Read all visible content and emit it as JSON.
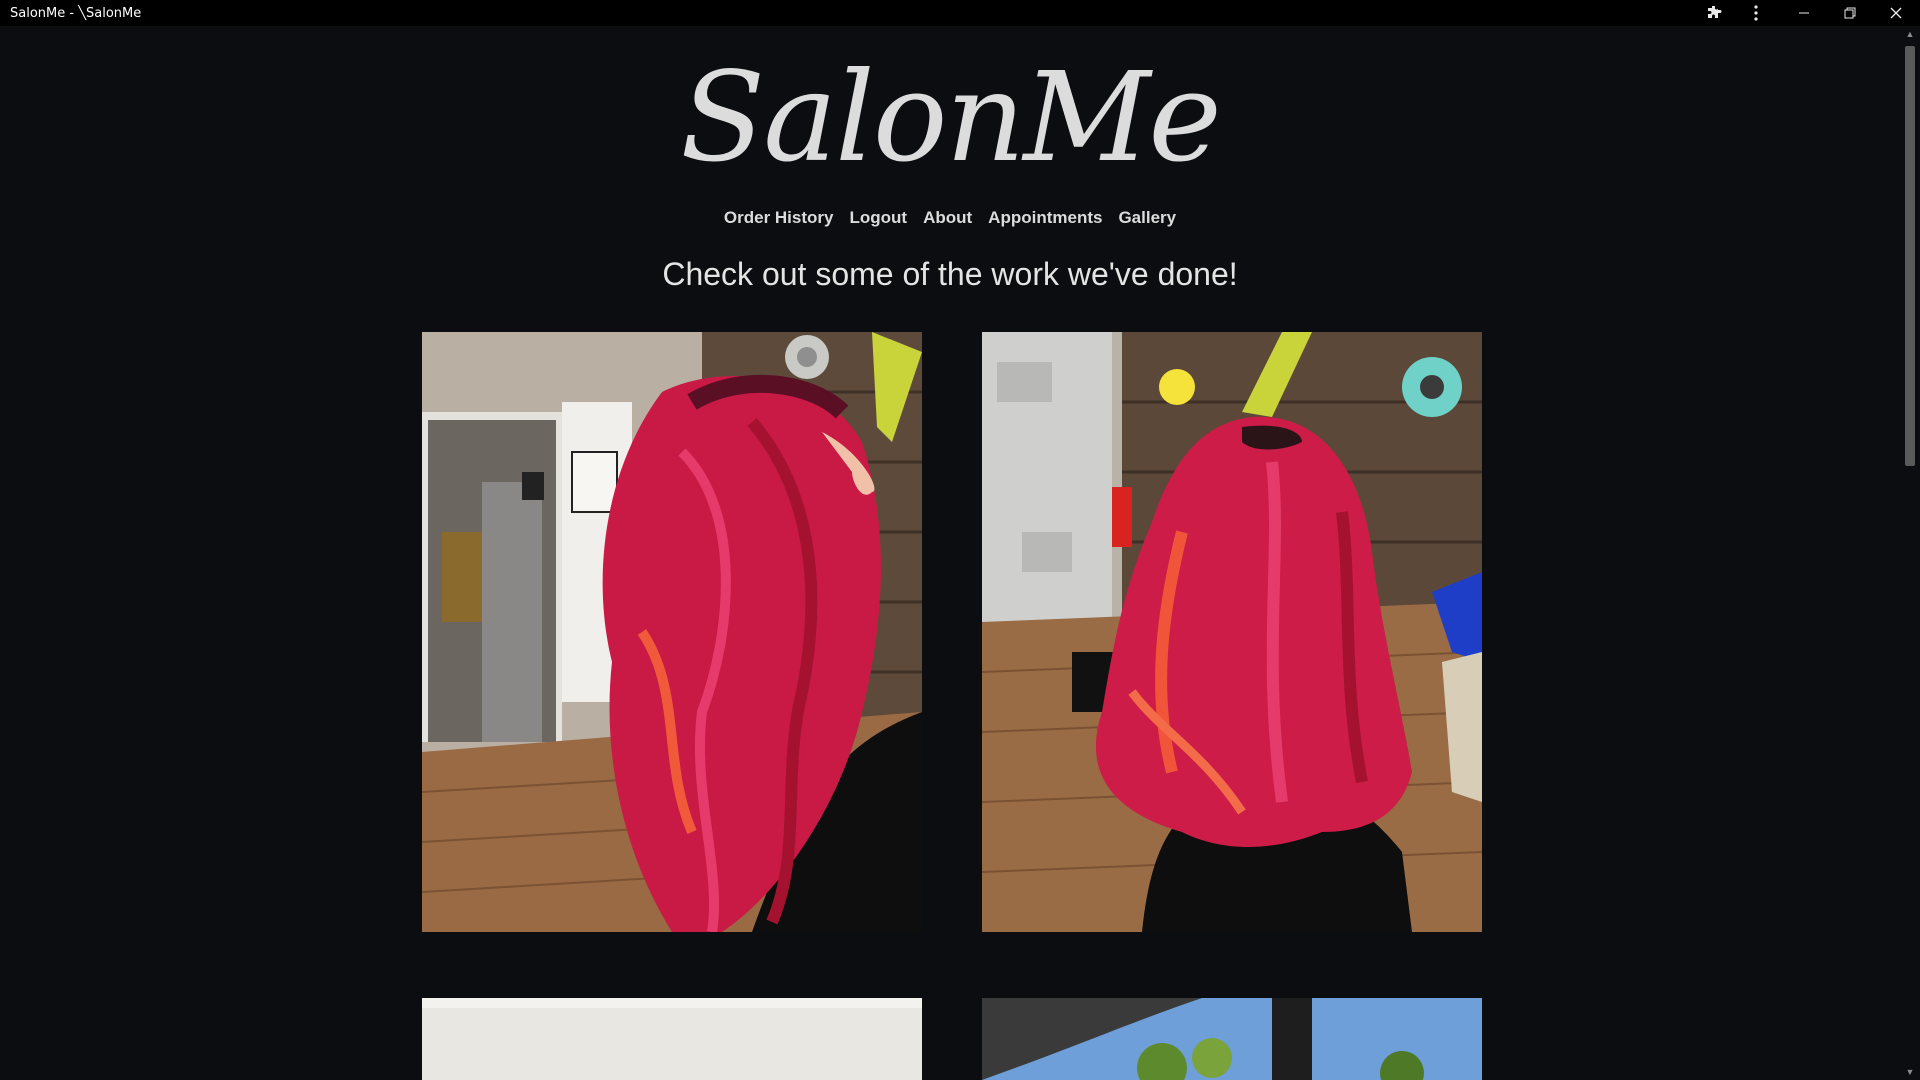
{
  "window": {
    "title": "SalonMe - ╲SalonMe",
    "icons": [
      "extensions-icon",
      "menu-icon",
      "minimize-icon",
      "restore-icon",
      "close-icon"
    ]
  },
  "site": {
    "logo": "SalonMe",
    "nav": [
      "Order History",
      "Logout",
      "About",
      "Appointments",
      "Gallery"
    ],
    "heading": "Check out some of the work we've done!"
  },
  "gallery": {
    "photos": [
      {
        "name": "gallery-photo-red-hair-side"
      },
      {
        "name": "gallery-photo-red-hair-back"
      },
      {
        "name": "gallery-photo-3"
      },
      {
        "name": "gallery-photo-4"
      }
    ]
  },
  "colors": {
    "background": "#0b0d10",
    "text": "#dcdcdc",
    "hair": "#d8204a"
  }
}
